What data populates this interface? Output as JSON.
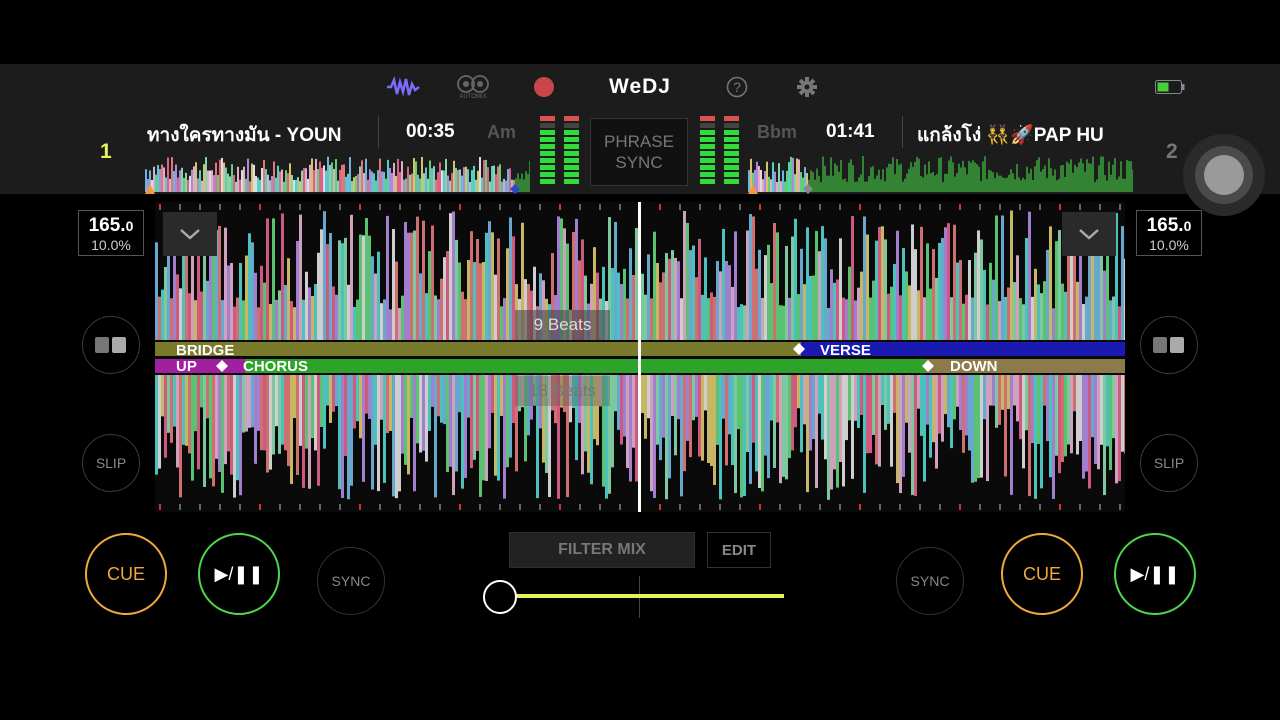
{
  "header": {
    "logo": "WeDJ",
    "automix_label": "AUTOMIX",
    "accent_wave_color": "#7b6cff",
    "record_color": "#d9534f",
    "battery_color": "#46d13c"
  },
  "deck1": {
    "number": "1",
    "track": "ทางใครทางมัน - YOUN",
    "time": "00:35",
    "key": "Am",
    "bpm": "165.",
    "bpm_decimal": "0",
    "pitch": "10.0%",
    "cue_label": "CUE",
    "play_label": "▶/❚❚",
    "sync_label": "SYNC",
    "slip_label": "SLIP",
    "number_color": "#e8f25a"
  },
  "deck2": {
    "number": "2",
    "track": "แกล้งโง่ 👯‍♂️🚀PAP HU",
    "time": "01:41",
    "key": "Bbm",
    "bpm": "165.",
    "bpm_decimal": "0",
    "pitch": "10.0%",
    "cue_label": "CUE",
    "play_label": "▶/❚❚",
    "sync_label": "SYNC",
    "slip_label": "SLIP",
    "number_color": "#777777"
  },
  "phrase_sync": {
    "line1": "PHRASE",
    "line2": "SYNC"
  },
  "waveform": {
    "beats_upper": "9 Beats",
    "beats_lower": "18 Beats",
    "deck1_segments": [
      "BRIDGE"
    ],
    "deck1_segments_right": [
      "VERSE"
    ],
    "deck2_segments": [
      "UP",
      "CHORUS"
    ],
    "deck2_segments_right": [
      "DOWN"
    ],
    "colors": {
      "bridge": "#7a7a2c",
      "verse": "#1a1ab0",
      "up": "#a020a0",
      "chorus": "#2ea32a",
      "down": "#8c7a4a"
    }
  },
  "mixer": {
    "filter_mix_label": "FILTER MIX",
    "edit_label": "EDIT",
    "crossfader_color": "#e6f05a"
  },
  "icons": [
    "waveform-icon",
    "automix-icon",
    "record-icon",
    "help-icon",
    "settings-icon",
    "battery-icon",
    "chevron-down-icon",
    "split-view-icon",
    "assistive-touch-icon"
  ]
}
